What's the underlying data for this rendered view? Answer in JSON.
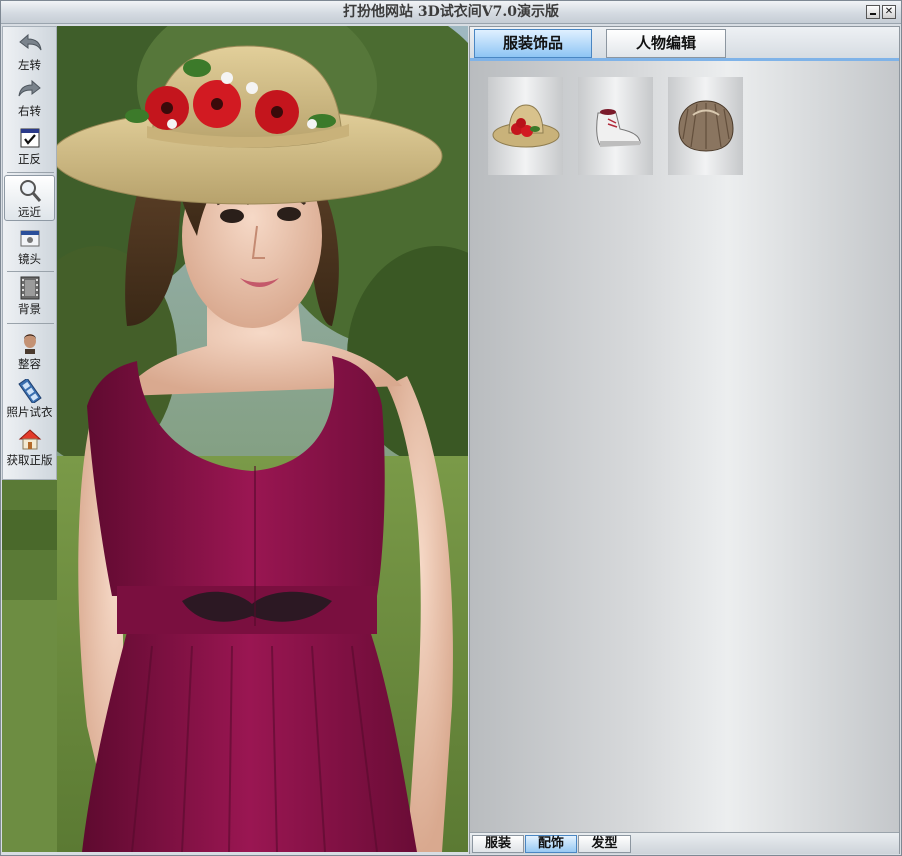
{
  "window": {
    "title": "打扮他网站 3D试衣间V7.0演示版",
    "minimize_icon": "minimize-icon",
    "close_icon": "close-icon",
    "close_glyph": "✕"
  },
  "toolbar": {
    "items": [
      {
        "id": "rotate-left",
        "label": "左转",
        "icon": "arrow-left-icon"
      },
      {
        "id": "rotate-right",
        "label": "右转",
        "icon": "arrow-right-icon"
      },
      {
        "id": "front-back",
        "label": "正反",
        "icon": "checkbox-icon"
      },
      {
        "id": "zoom",
        "label": "远近",
        "icon": "magnifier-icon",
        "selected": true
      },
      {
        "id": "camera",
        "label": "镜头",
        "icon": "camera-icon"
      },
      {
        "id": "background",
        "label": "背景",
        "icon": "film-icon"
      },
      {
        "id": "face-edit",
        "label": "整容",
        "icon": "face-icon"
      },
      {
        "id": "photo-tryon",
        "label": "照片试衣",
        "icon": "film-strip-icon"
      },
      {
        "id": "get-full",
        "label": "获取正版",
        "icon": "house-icon"
      }
    ]
  },
  "panel": {
    "tabs": [
      {
        "label": "服装饰品",
        "active": true
      },
      {
        "label": "人物编辑",
        "active": false
      }
    ],
    "items": [
      {
        "name": "hat",
        "icon": "straw-hat-icon"
      },
      {
        "name": "shoes",
        "icon": "sneaker-icon"
      },
      {
        "name": "hair",
        "icon": "hair-bun-icon"
      }
    ],
    "bottom_tabs": [
      {
        "label": "服装",
        "active": false
      },
      {
        "label": "配饰",
        "active": true
      },
      {
        "label": "发型",
        "active": false
      }
    ]
  },
  "colors": {
    "accent": "#7fb3e8",
    "dress": "#8a1247"
  }
}
